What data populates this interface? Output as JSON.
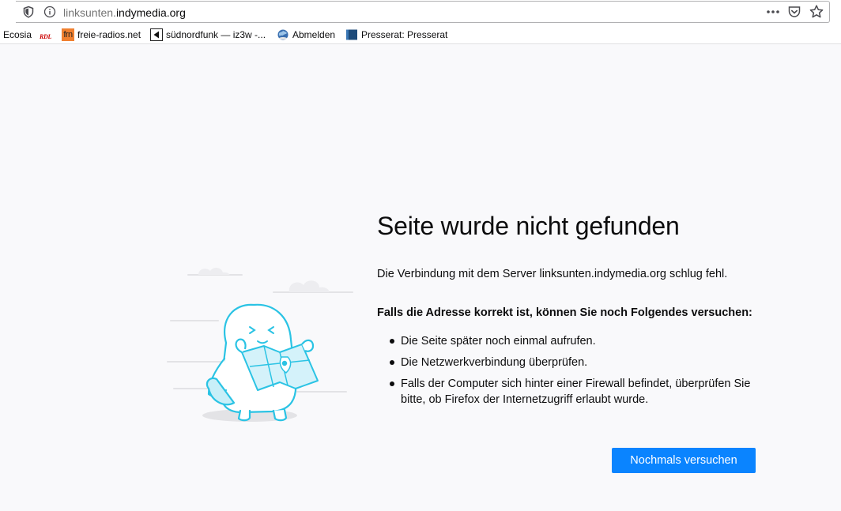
{
  "urlbar": {
    "url_prefix": "linksunten.",
    "url_host": "indymedia.org"
  },
  "bookmarks": [
    {
      "label": "Ecosia"
    },
    {
      "icon_text": "RDL"
    },
    {
      "icon_text": "frn",
      "label": "freie-radios.net"
    },
    {
      "label": "südnordfunk — iz3w -..."
    },
    {
      "label": "Abmelden"
    },
    {
      "label": "Presserat: Presserat"
    }
  ],
  "error": {
    "title": "Seite wurde nicht gefunden",
    "description": "Die Verbindung mit dem Server linksunten.indymedia.org schlug fehl.",
    "try_heading": "Falls die Adresse korrekt ist, können Sie noch Folgendes versuchen:",
    "tips": [
      "Die Seite später noch einmal aufrufen.",
      "Die Netzwerkverbindung überprüfen.",
      "Falls der Computer sich hinter einer Firewall befindet, überprüfen Sie bitte, ob Firefox der Internetzugriff erlaubt wurde."
    ],
    "retry_label": "Nochmals versuchen"
  },
  "colors": {
    "accent": "#0a84ff",
    "background": "#f9f9fb",
    "illustration": "#2ac3e4"
  },
  "icons": [
    "tracking-shield-icon",
    "info-icon",
    "more-icon",
    "pocket-icon",
    "bookmark-star-icon",
    "lost-map-illustration"
  ]
}
